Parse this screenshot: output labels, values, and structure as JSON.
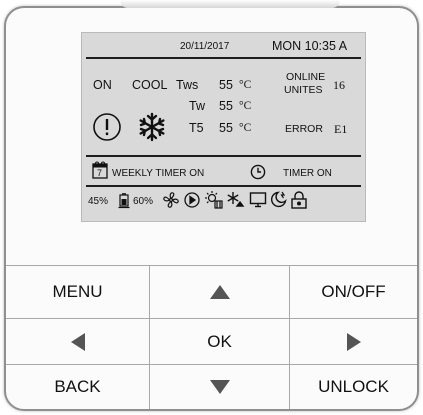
{
  "status_bar": {
    "date": "20/11/2017",
    "day_time": "MON 10:35 A"
  },
  "mode": {
    "power_state": "ON",
    "operation": "COOL"
  },
  "temperatures": [
    {
      "label": "Tws",
      "value": "55",
      "unit": "°C"
    },
    {
      "label": "Tw",
      "value": "55",
      "unit": "°C"
    },
    {
      "label": "T5",
      "value": "55",
      "unit": "°C"
    }
  ],
  "online_units": {
    "label_line1": "ONLINE",
    "label_line2": "UNITES",
    "value": "16"
  },
  "error": {
    "label": "ERROR",
    "code": "E1"
  },
  "timers": {
    "weekly_calendar_number": "7",
    "weekly_label": "WEEKLY TIMER ON",
    "timer_label": "TIMER ON"
  },
  "indicators": {
    "percent_1": "45%",
    "percent_2": "60%"
  },
  "icons": [
    "warning-icon",
    "snowflake-icon",
    "calendar-icon",
    "clock-icon",
    "humidity-icon",
    "fan-icon",
    "pump-icon",
    "sun-heater-icon",
    "defrost-icon",
    "screen-icon",
    "night-mode-icon",
    "lock-icon"
  ],
  "keys": {
    "menu": "MENU",
    "on_off": "ON/OFF",
    "ok": "OK",
    "back": "BACK",
    "unlock": "UNLOCK"
  },
  "colors": {
    "screen_bg": "#d9d9d9",
    "frame": "#8f8f8f",
    "text": "#111111"
  }
}
